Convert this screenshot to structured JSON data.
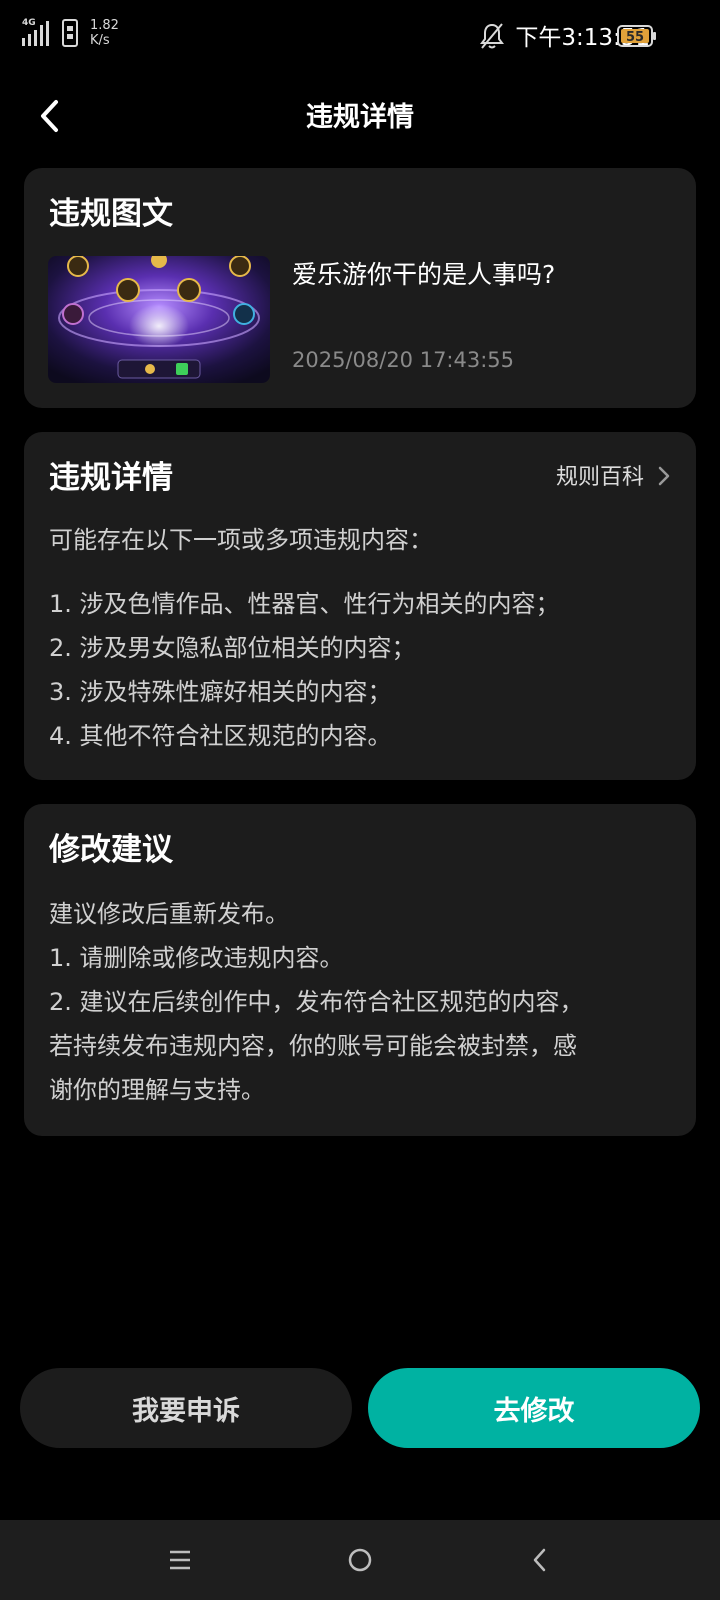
{
  "status_bar": {
    "network_type": "4G",
    "speed_value": "1.82",
    "speed_unit": "K/s",
    "time": "下午3:13:51",
    "battery_level": "55",
    "battery_color": "#e0a13a"
  },
  "header": {
    "title": "违规详情"
  },
  "content_card": {
    "title": "违规图文",
    "post_title": "爱乐游你干的是人事吗?",
    "post_date": "2025/08/20 17:43:55"
  },
  "violation_card": {
    "title": "违规详情",
    "rules_link": "规则百科",
    "intro": "可能存在以下一项或多项违规内容：",
    "items": [
      "1. 涉及色情作品、性器官、性行为相关的内容；",
      "2. 涉及男女隐私部位相关的内容；",
      "3. 涉及特殊性癖好相关的内容；",
      "4. 其他不符合社区规范的内容。"
    ]
  },
  "suggestion_card": {
    "title": "修改建议",
    "lines": [
      "建议修改后重新发布。",
      "1. 请删除或修改违规内容。",
      "2. 建议在后续创作中，发布符合社区规范的内容，",
      "若持续发布违规内容，你的账号可能会被封禁，感",
      "谢你的理解与支持。"
    ]
  },
  "actions": {
    "appeal_label": "我要申诉",
    "modify_label": "去修改"
  },
  "colors": {
    "accent": "#00b2a2",
    "card_bg": "#1c1c1c",
    "page_bg": "#000000"
  },
  "icons": {
    "status": [
      "signal-icon",
      "sim-icon",
      "bell-muted-icon",
      "battery-icon"
    ],
    "header": "back-arrow-icon",
    "rules_link": "chevron-right-icon",
    "nav": [
      "menu-icon",
      "home-icon",
      "back-icon"
    ]
  }
}
